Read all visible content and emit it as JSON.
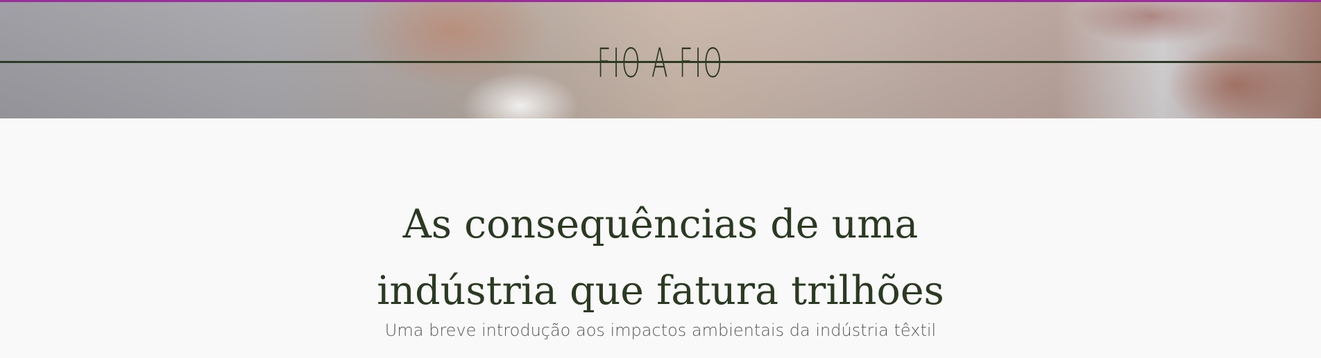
{
  "colors": {
    "accent": "#9b2c9b",
    "brand_green": "#2b3a22",
    "background": "#f9f9f9",
    "subtitle_gray": "#555555"
  },
  "header": {
    "brand": "FIO A FIO"
  },
  "article": {
    "title_line1": "As consequências de uma",
    "title_line2": "indústria que fatura trilhões",
    "subtitle": "Uma breve introdução aos impactos ambientais da indústria têxtil"
  }
}
